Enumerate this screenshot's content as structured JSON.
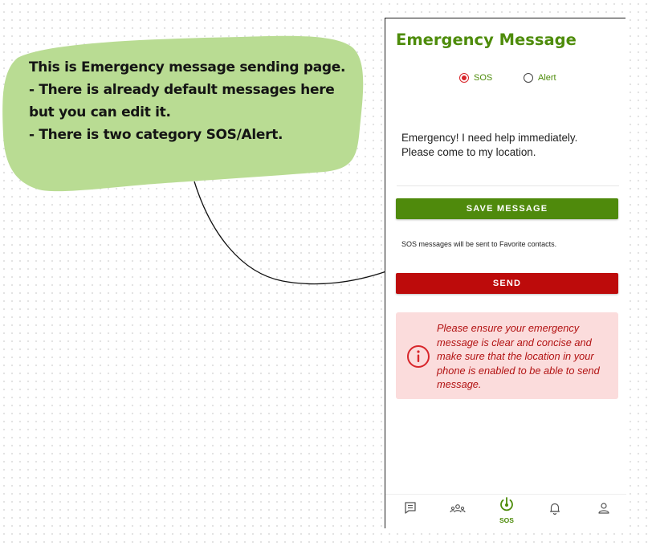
{
  "annotation": {
    "lines": [
      "This is Emergency message sending page.",
      "- There is already default messages here",
      "but you can edit it.",
      "- There is two category SOS/Alert."
    ],
    "bubble_color": "#b9dc93"
  },
  "app": {
    "title": "Emergency Message",
    "radio_options": [
      {
        "label": "SOS",
        "selected": true
      },
      {
        "label": "Alert",
        "selected": false
      }
    ],
    "message_text": "Emergency! I need help immediately. Please come to my location.",
    "save_button": "SAVE MESSAGE",
    "hint": "SOS messages will be sent to Favorite contacts.",
    "send_button": "SEND",
    "warning": "Please ensure your emergency message is clear and concise and make sure that the location in your phone is enabled to be able to send message.",
    "nav": {
      "items": [
        "messages-icon",
        "contacts-icon",
        "sos-icon",
        "notifications-icon",
        "profile-icon"
      ],
      "active_label": "SOS"
    },
    "colors": {
      "accent_green": "#4e8c0b",
      "send_red": "#bd0b0b",
      "warning_bg": "#fbdcdc"
    }
  }
}
